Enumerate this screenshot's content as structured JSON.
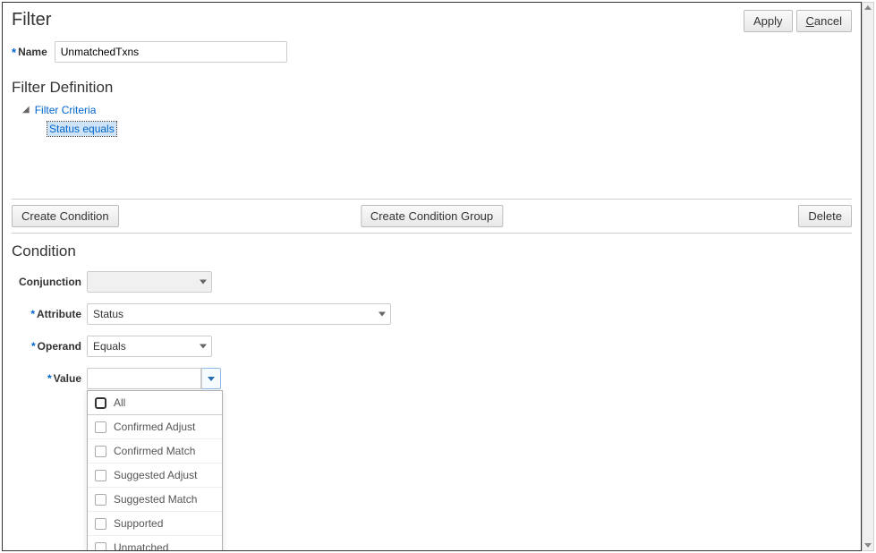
{
  "page": {
    "title": "Filter"
  },
  "actions": {
    "apply": "Apply",
    "cancel": "Cancel"
  },
  "nameField": {
    "label": "Name",
    "value": "UnmatchedTxns"
  },
  "definition": {
    "title": "Filter Definition",
    "treeRoot": "Filter Criteria",
    "treeSelected": "Status equals"
  },
  "actionBar": {
    "createCondition": "Create Condition",
    "createGroup": "Create Condition Group",
    "delete": "Delete"
  },
  "condition": {
    "title": "Condition",
    "conjunctionLabel": "Conjunction",
    "conjunctionValue": "",
    "attributeLabel": "Attribute",
    "attributeValue": "Status",
    "operandLabel": "Operand",
    "operandValue": "Equals",
    "valueLabel": "Value",
    "valueValue": "",
    "options": [
      "All",
      "Confirmed Adjust",
      "Confirmed Match",
      "Suggested Adjust",
      "Suggested Match",
      "Supported",
      "Unmatched"
    ]
  }
}
